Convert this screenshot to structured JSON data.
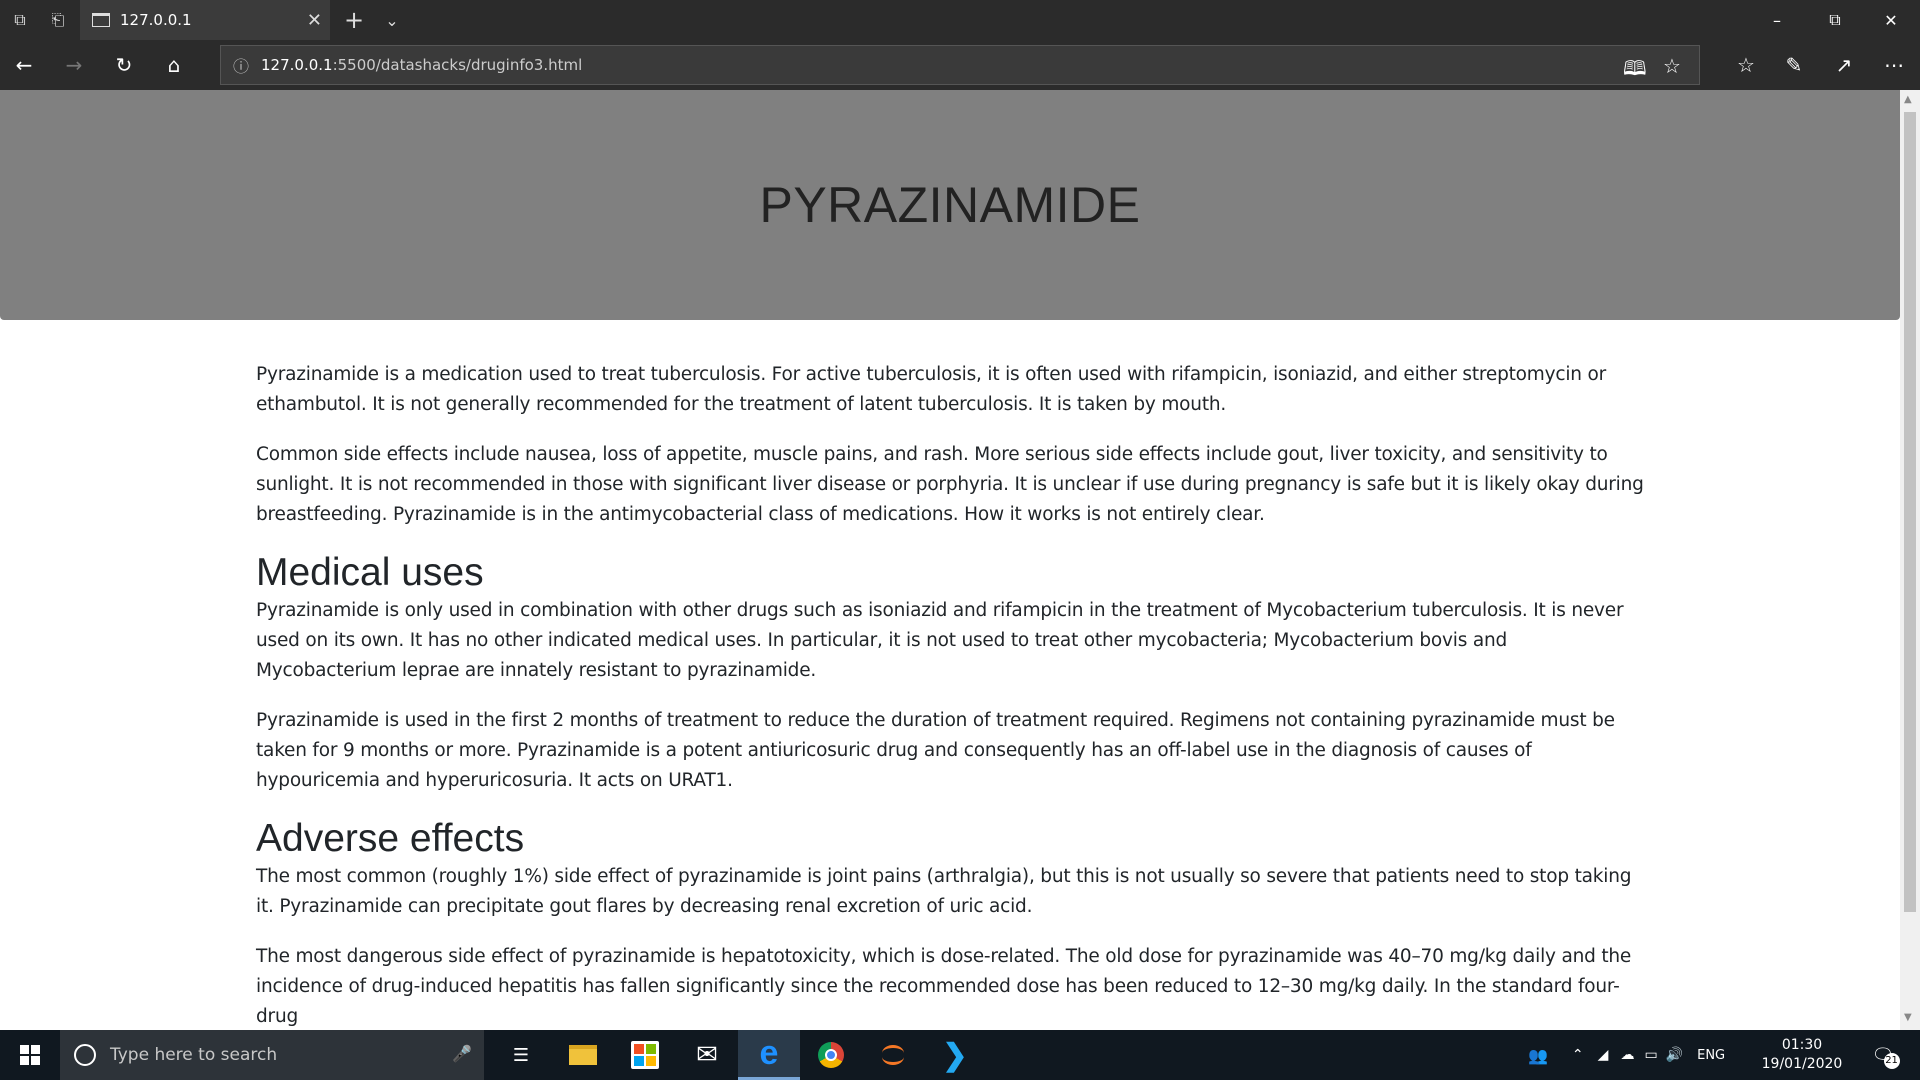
{
  "browser": {
    "tab_title": "127.0.0.1",
    "url_host": "127.0.0.1",
    "url_path": ":5500/datashacks/druginfo3.html"
  },
  "page": {
    "title": "PYRAZINAMIDE",
    "intro": [
      "Pyrazinamide is a medication used to treat tuberculosis. For active tuberculosis, it is often used with rifampicin, isoniazid, and either streptomycin or ethambutol. It is not generally recommended for the treatment of latent tuberculosis. It is taken by mouth.",
      "Common side effects include nausea, loss of appetite, muscle pains, and rash. More serious side effects include gout, liver toxicity, and sensitivity to sunlight. It is not recommended in those with significant liver disease or porphyria. It is unclear if use during pregnancy is safe but it is likely okay during breastfeeding. Pyrazinamide is in the antimycobacterial class of medications. How it works is not entirely clear."
    ],
    "sections": [
      {
        "heading": "Medical uses",
        "paragraphs": [
          "Pyrazinamide is only used in combination with other drugs such as isoniazid and rifampicin in the treatment of Mycobacterium tuberculosis. It is never used on its own. It has no other indicated medical uses. In particular, it is not used to treat other mycobacteria; Mycobacterium bovis and Mycobacterium leprae are innately resistant to pyrazinamide.",
          "Pyrazinamide is used in the first 2 months of treatment to reduce the duration of treatment required. Regimens not containing pyrazinamide must be taken for 9 months or more. Pyrazinamide is a potent antiuricosuric drug and consequently has an off-label use in the diagnosis of causes of hypouricemia and hyperuricosuria. It acts on URAT1."
        ]
      },
      {
        "heading": "Adverse effects",
        "paragraphs": [
          "The most common (roughly 1%) side effect of pyrazinamide is joint pains (arthralgia), but this is not usually so severe that patients need to stop taking it. Pyrazinamide can precipitate gout flares by decreasing renal excretion of uric acid.",
          "The most dangerous side effect of pyrazinamide is hepatotoxicity, which is dose-related. The old dose for pyrazinamide was 40–70 mg/kg daily and the incidence of drug-induced hepatitis has fallen significantly since the recommended dose has been reduced to 12–30 mg/kg daily. In the standard four-drug"
        ]
      }
    ]
  },
  "taskbar": {
    "search_placeholder": "Type here to search",
    "language": "ENG",
    "time": "01:30",
    "date": "19/01/2020",
    "notifications": "21"
  }
}
